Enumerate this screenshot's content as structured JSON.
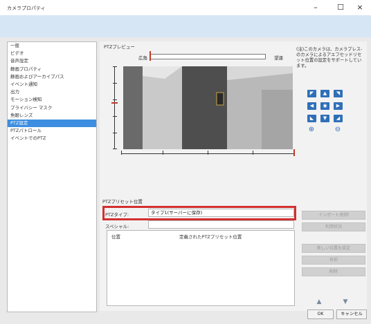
{
  "window": {
    "title": "カメラプロパティ",
    "minimize_glyph": "–",
    "maximize_glyph": "☐",
    "close_glyph": "×"
  },
  "sidebar": {
    "items": [
      "一般",
      "ビデオ",
      "音声設定",
      "静画プロパティ",
      "静画およびアーカイブパス",
      "イベント通知",
      "出力",
      "モーション検知",
      "プライバシー マスク",
      "魚眼レンズ",
      "PTZ設定",
      "PTZパトロール",
      "イベントでのPTZ"
    ],
    "selected_index": 10
  },
  "ptz_preview": {
    "label": "PTZプレビュー",
    "zoom_wide": "広角",
    "zoom_tele": "望遠"
  },
  "note": {
    "text": "(注)このカメラは、カメラプレス-のカメラによるアエフセッドリセット位置の設定をサポートしています。"
  },
  "ptz_controls": {
    "up_left": "◤",
    "up": "▲",
    "up_right": "◥",
    "left": "◀",
    "home": "◉",
    "right": "▶",
    "down_left": "◣",
    "down": "▼",
    "down_right": "◢",
    "zoom_in": "⊕",
    "zoom_out": "⊖"
  },
  "preset": {
    "section_label": "PTZプリセット位置",
    "type_label": "PTZタイプ:",
    "type_value": "タイプ1(サーバーに保存)",
    "speed_label": "スペシャル:",
    "speed_value": "",
    "list_headers": [
      "位置",
      "定義されたPTZプリセット位置"
    ]
  },
  "right_buttons": {
    "b1": "インポート/削除",
    "b2": "利用状況",
    "b3": "新しい位置を設定",
    "b4": "名前",
    "b5": "削除"
  },
  "footer": {
    "ok": "OK",
    "cancel": "キャンセル",
    "up_arrow": "▲",
    "down_arrow": "▼"
  }
}
